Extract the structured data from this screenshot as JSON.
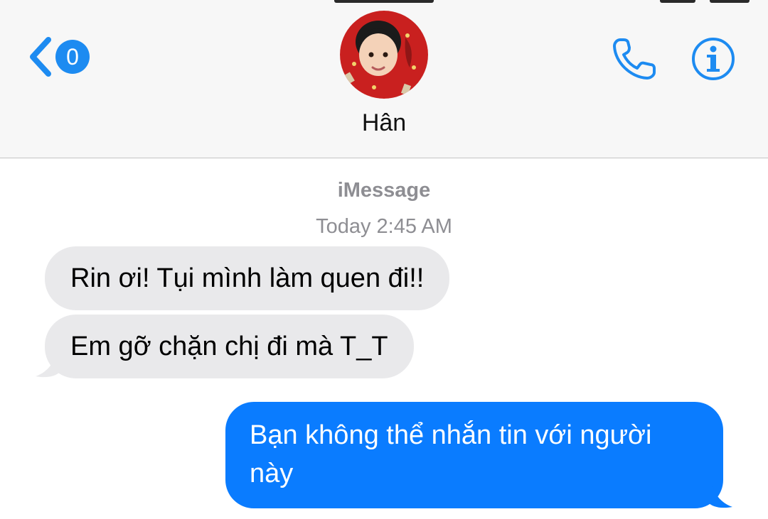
{
  "header": {
    "back_badge": "0",
    "contact_name": "Hân",
    "accent_color": "#1d8bf1",
    "back_icon": "chevron-left-icon",
    "call_icon": "phone-icon",
    "info_icon": "info-circle-icon"
  },
  "thread": {
    "service": "iMessage",
    "timestamp": "Today 2:45 AM",
    "messages": [
      {
        "direction": "incoming",
        "text": "Rin ơi! Tụi mình làm quen đi!!"
      },
      {
        "direction": "incoming",
        "text": "Em gỡ chặn chị đi mà T_T"
      },
      {
        "direction": "outgoing",
        "text": "Bạn không thể nhắn tin với người này"
      }
    ],
    "incoming_color": "#e9e9eb",
    "outgoing_color": "#0a7cff"
  }
}
